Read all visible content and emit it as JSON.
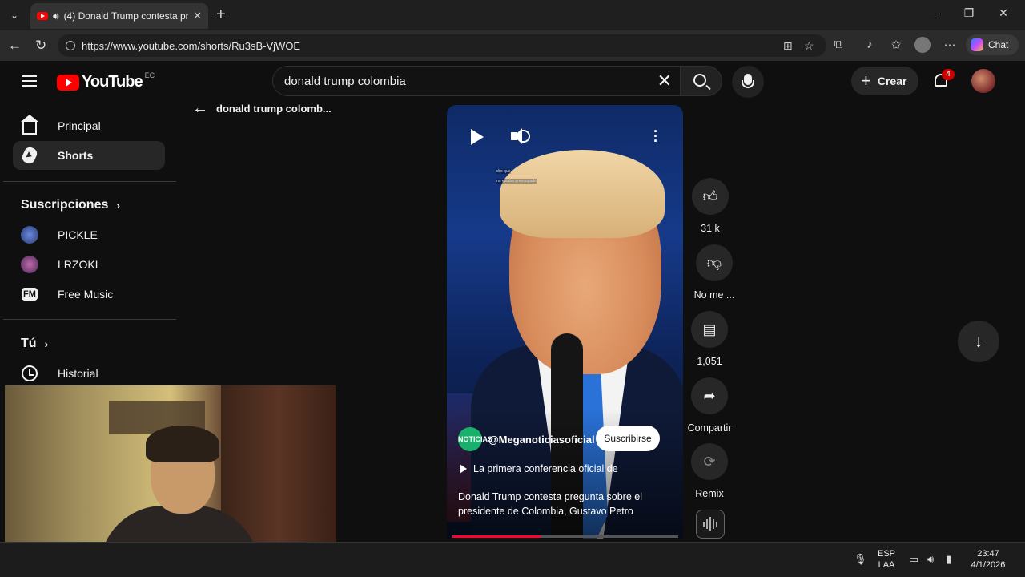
{
  "browser": {
    "tab_title": "(4) Donald Trump contesta pr",
    "url": "https://www.youtube.com/shorts/Ru3sB-VjWOE",
    "copilot_label": "Chat"
  },
  "header": {
    "logo_text": "YouTube",
    "country_code": "EC",
    "search_value": "donald trump colombia",
    "create_label": "Crear",
    "notification_count": "4"
  },
  "sidebar": {
    "home_label": "Principal",
    "shorts_label": "Shorts",
    "subscriptions_heading": "Suscripciones",
    "subscriptions": [
      {
        "label": "PICKLE"
      },
      {
        "label": "LRZOKI"
      },
      {
        "label": "Free Music"
      }
    ],
    "you_heading": "Tú",
    "history_label": "Historial"
  },
  "back_row": {
    "label": "donald trump colomb..."
  },
  "short": {
    "channel_name": "@Meganoticiasoficial",
    "channel_logo_text": "NOTICIAS",
    "subscribe_label": "Suscribirse",
    "description_link": "La primera conferencia oficial de",
    "caption": "Donald Trump contesta pregunta sobre el presidente de Colombia, Gustavo Petro",
    "overlay_text_1": "dijo que",
    "overlay_text_2": "no estaba preocupado",
    "progress_fraction": 0.39
  },
  "actions": {
    "like_count": "31 k",
    "dislike_label": "No me ...",
    "comment_count": "1,051",
    "share_label": "Compartir",
    "remix_label": "Remix"
  },
  "taskbar": {
    "lang_line1": "ESP",
    "lang_line2": "LAA",
    "time": "23:47",
    "date": "4/1/2026"
  },
  "colors": {
    "brand_red": "#ff0000",
    "badge_red": "#cc0000",
    "background": "#0f0f0f",
    "progress": "#ff0033"
  }
}
